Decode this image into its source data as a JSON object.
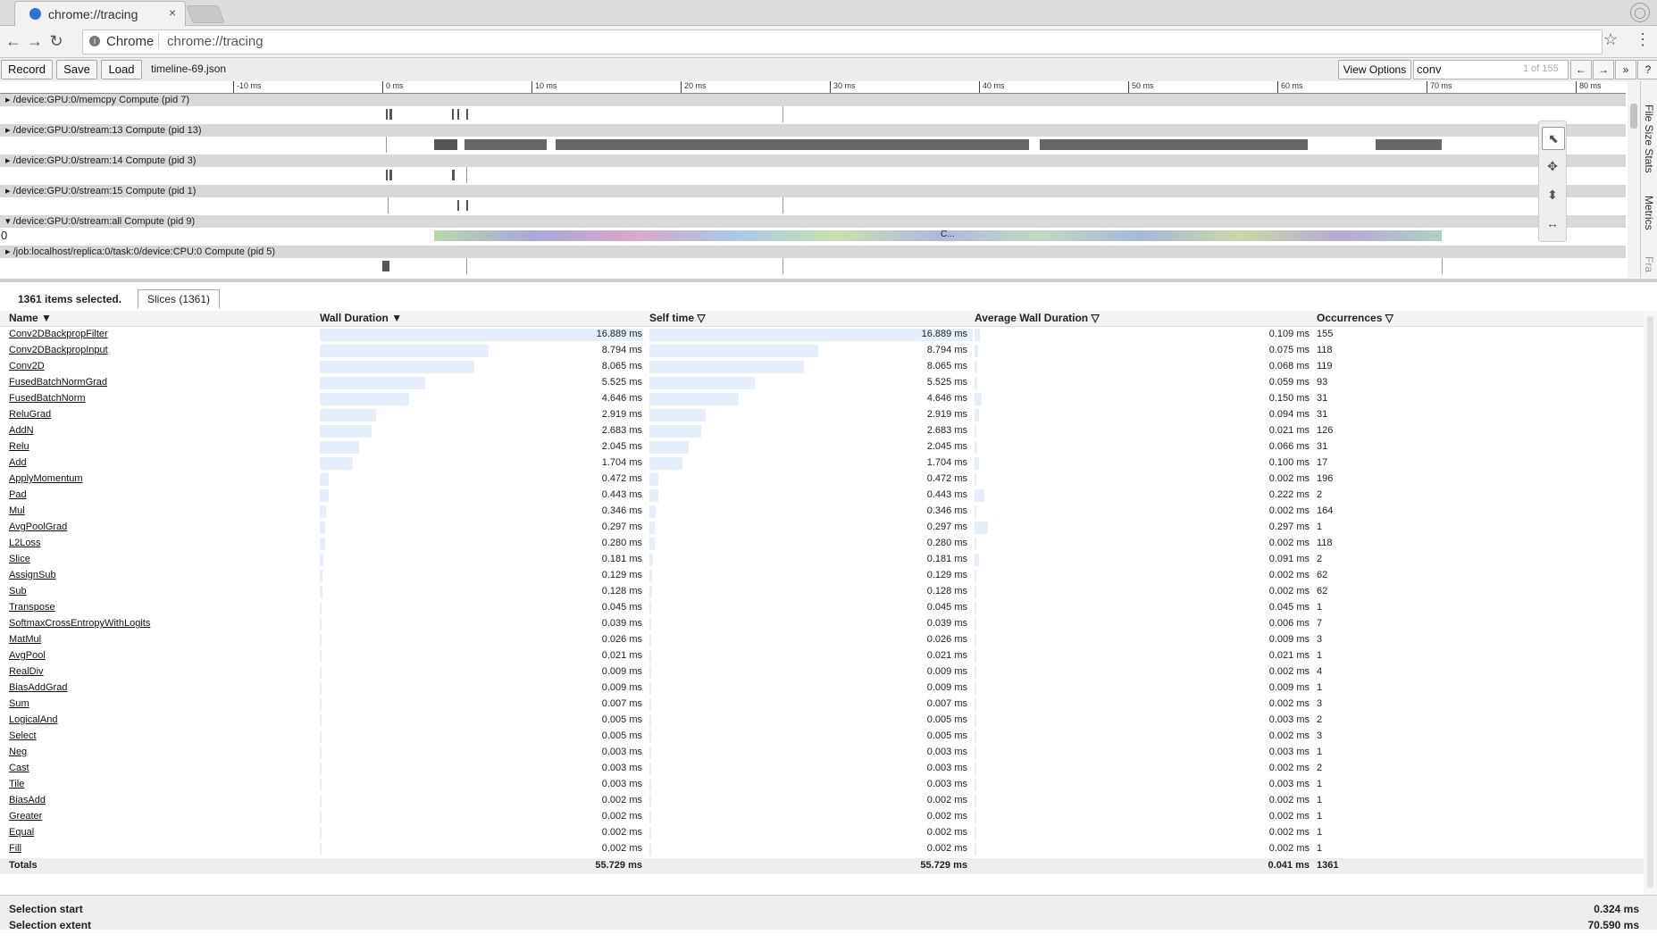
{
  "browser": {
    "tab_title": "chrome://tracing",
    "tab_close": "×",
    "omnibox_label": "Chrome",
    "url": "chrome://tracing",
    "info_glyph": "i",
    "nav_back": "←",
    "nav_forward": "→",
    "nav_reload": "↻",
    "bookmark_glyph": "☆",
    "menu_glyph": "⋮",
    "profile_glyph": "◯"
  },
  "controls": {
    "record": "Record",
    "save": "Save",
    "load": "Load",
    "filename": "timeline-69.json",
    "view_options": "View Options",
    "search_value": "conv",
    "search_count": "1 of 155",
    "prev": "←",
    "next": "→",
    "more": "»",
    "help": "?"
  },
  "ruler": {
    "ticks": [
      "-10 ms",
      "0 ms",
      "10 ms",
      "20 ms",
      "30 ms",
      "40 ms",
      "50 ms",
      "60 ms",
      "70 ms",
      "80 ms"
    ]
  },
  "tracks": [
    {
      "label": "▸ /device:GPU:0/memcpy Compute (pid 7)"
    },
    {
      "label": "▸ /device:GPU:0/stream:13 Compute (pid 13)"
    },
    {
      "label": "▸ /device:GPU:0/stream:14 Compute (pid 3)"
    },
    {
      "label": "▸ /device:GPU:0/stream:15 Compute (pid 1)"
    },
    {
      "label": "▾ /device:GPU:0/stream:all Compute (pid 9)"
    },
    {
      "label": "▸ /job:localhost/replica:0/task:0/device:CPU:0 Compute (pid 5)"
    }
  ],
  "stream_all": {
    "row_value": "0",
    "slice_label": "C..."
  },
  "side_tabs": {
    "file_size": "File Size Stats",
    "metrics": "Metrics",
    "frame": "Fra"
  },
  "tools": {
    "select": "⬉",
    "pan": "✥",
    "zoom": "⬍",
    "timing": "↔"
  },
  "analysis": {
    "selected": "1361 items selected.",
    "slices_tab": "Slices (1361)",
    "headers": {
      "name": "Name ▼",
      "wall": "Wall Duration ▼",
      "self": "Self time ▽",
      "avg": "Average Wall Duration ▽",
      "occ": "Occurrences ▽"
    },
    "rows": [
      {
        "name": "Conv2DBackpropFilter",
        "wall": "16.889 ms",
        "self": "16.889 ms",
        "avg": "0.109 ms",
        "occ": "155"
      },
      {
        "name": "Conv2DBackpropInput",
        "wall": "8.794 ms",
        "self": "8.794 ms",
        "avg": "0.075 ms",
        "occ": "118"
      },
      {
        "name": "Conv2D",
        "wall": "8.065 ms",
        "self": "8.065 ms",
        "avg": "0.068 ms",
        "occ": "119"
      },
      {
        "name": "FusedBatchNormGrad",
        "wall": "5.525 ms",
        "self": "5.525 ms",
        "avg": "0.059 ms",
        "occ": "93"
      },
      {
        "name": "FusedBatchNorm",
        "wall": "4.646 ms",
        "self": "4.646 ms",
        "avg": "0.150 ms",
        "occ": "31"
      },
      {
        "name": "ReluGrad",
        "wall": "2.919 ms",
        "self": "2.919 ms",
        "avg": "0.094 ms",
        "occ": "31"
      },
      {
        "name": "AddN",
        "wall": "2.683 ms",
        "self": "2.683 ms",
        "avg": "0.021 ms",
        "occ": "126"
      },
      {
        "name": "Relu",
        "wall": "2.045 ms",
        "self": "2.045 ms",
        "avg": "0.066 ms",
        "occ": "31"
      },
      {
        "name": "Add",
        "wall": "1.704 ms",
        "self": "1.704 ms",
        "avg": "0.100 ms",
        "occ": "17"
      },
      {
        "name": "ApplyMomentum",
        "wall": "0.472 ms",
        "self": "0.472 ms",
        "avg": "0.002 ms",
        "occ": "196"
      },
      {
        "name": "Pad",
        "wall": "0.443 ms",
        "self": "0.443 ms",
        "avg": "0.222 ms",
        "occ": "2"
      },
      {
        "name": "Mul",
        "wall": "0.346 ms",
        "self": "0.346 ms",
        "avg": "0.002 ms",
        "occ": "164"
      },
      {
        "name": "AvgPoolGrad",
        "wall": "0.297 ms",
        "self": "0.297 ms",
        "avg": "0.297 ms",
        "occ": "1"
      },
      {
        "name": "L2Loss",
        "wall": "0.280 ms",
        "self": "0.280 ms",
        "avg": "0.002 ms",
        "occ": "118"
      },
      {
        "name": "Slice",
        "wall": "0.181 ms",
        "self": "0.181 ms",
        "avg": "0.091 ms",
        "occ": "2"
      },
      {
        "name": "AssignSub",
        "wall": "0.129 ms",
        "self": "0.129 ms",
        "avg": "0.002 ms",
        "occ": "62"
      },
      {
        "name": "Sub",
        "wall": "0.128 ms",
        "self": "0.128 ms",
        "avg": "0.002 ms",
        "occ": "62"
      },
      {
        "name": "Transpose",
        "wall": "0.045 ms",
        "self": "0.045 ms",
        "avg": "0.045 ms",
        "occ": "1"
      },
      {
        "name": "SoftmaxCrossEntropyWithLogits",
        "wall": "0.039 ms",
        "self": "0.039 ms",
        "avg": "0.006 ms",
        "occ": "7"
      },
      {
        "name": "MatMul",
        "wall": "0.026 ms",
        "self": "0.026 ms",
        "avg": "0.009 ms",
        "occ": "3"
      },
      {
        "name": "AvgPool",
        "wall": "0.021 ms",
        "self": "0.021 ms",
        "avg": "0.021 ms",
        "occ": "1"
      },
      {
        "name": "RealDiv",
        "wall": "0.009 ms",
        "self": "0.009 ms",
        "avg": "0.002 ms",
        "occ": "4"
      },
      {
        "name": "BiasAddGrad",
        "wall": "0.009 ms",
        "self": "0.009 ms",
        "avg": "0.009 ms",
        "occ": "1"
      },
      {
        "name": "Sum",
        "wall": "0.007 ms",
        "self": "0.007 ms",
        "avg": "0.002 ms",
        "occ": "3"
      },
      {
        "name": "LogicalAnd",
        "wall": "0.005 ms",
        "self": "0.005 ms",
        "avg": "0.003 ms",
        "occ": "2"
      },
      {
        "name": "Select",
        "wall": "0.005 ms",
        "self": "0.005 ms",
        "avg": "0.002 ms",
        "occ": "3"
      },
      {
        "name": "Neg",
        "wall": "0.003 ms",
        "self": "0.003 ms",
        "avg": "0.003 ms",
        "occ": "1"
      },
      {
        "name": "Cast",
        "wall": "0.003 ms",
        "self": "0.003 ms",
        "avg": "0.002 ms",
        "occ": "2"
      },
      {
        "name": "Tile",
        "wall": "0.003 ms",
        "self": "0.003 ms",
        "avg": "0.003 ms",
        "occ": "1"
      },
      {
        "name": "BiasAdd",
        "wall": "0.002 ms",
        "self": "0.002 ms",
        "avg": "0.002 ms",
        "occ": "1"
      },
      {
        "name": "Greater",
        "wall": "0.002 ms",
        "self": "0.002 ms",
        "avg": "0.002 ms",
        "occ": "1"
      },
      {
        "name": "Equal",
        "wall": "0.002 ms",
        "self": "0.002 ms",
        "avg": "0.002 ms",
        "occ": "1"
      },
      {
        "name": "Fill",
        "wall": "0.002 ms",
        "self": "0.002 ms",
        "avg": "0.002 ms",
        "occ": "1"
      }
    ],
    "totals": {
      "label": "Totals",
      "wall": "55.729 ms",
      "self": "55.729 ms",
      "avg": "0.041 ms",
      "occ": "1361"
    },
    "selection_start_label": "Selection start",
    "selection_start": "0.324 ms",
    "selection_extent_label": "Selection extent",
    "selection_extent": "70.590 ms"
  },
  "colors": {
    "bar_fill": "#e5eefb",
    "slice_dark": "#555555"
  }
}
